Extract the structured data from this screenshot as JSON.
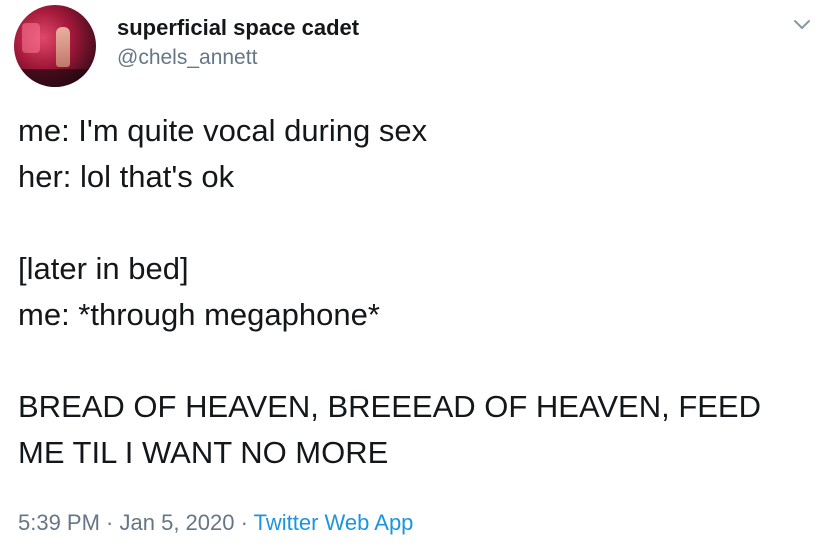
{
  "author": {
    "display_name": "superficial space cadet",
    "handle": "@chels_annett"
  },
  "tweet": {
    "text": "me: I'm quite vocal during sex\nher: lol that's ok\n\n[later in bed]\nme: *through megaphone*\n\nBREAD OF HEAVEN, BREEEAD OF HEAVEN, FEED ME TIL I WANT NO MORE"
  },
  "meta": {
    "time": "5:39 PM",
    "separator1": " · ",
    "date": "Jan 5, 2020",
    "separator2": " · ",
    "source": "Twitter Web App"
  },
  "icons": {
    "menu": "chevron-down-icon"
  },
  "colors": {
    "text": "#14171a",
    "secondary": "#657786",
    "link": "#1b95e0"
  }
}
